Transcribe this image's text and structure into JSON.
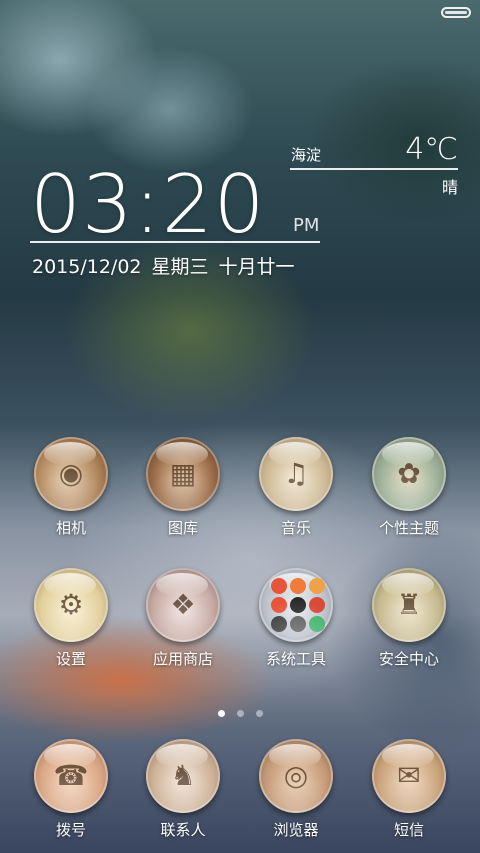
{
  "clock": {
    "time": "03:20",
    "ampm": "PM",
    "date": "2015/12/02",
    "weekday": "星期三",
    "lunar": "十月廿一"
  },
  "weather": {
    "city": "海淀",
    "temp": "4℃",
    "condition": "晴"
  },
  "apps_row1": [
    {
      "label": "相机",
      "icon": "camera-icon",
      "color": "#b98a5c",
      "glyph": "◉"
    },
    {
      "label": "图库",
      "icon": "gallery-icon",
      "color": "#8a6a55",
      "glyph": "▦"
    },
    {
      "label": "音乐",
      "icon": "music-icon",
      "color": "#d9c7a8",
      "glyph": "♫"
    },
    {
      "label": "个性主题",
      "icon": "theme-icon",
      "color": "#9fb39a",
      "glyph": "✿"
    }
  ],
  "apps_row2": [
    {
      "label": "设置",
      "icon": "settings-icon",
      "color": "#e2d2a6",
      "glyph": "⚙"
    },
    {
      "label": "应用商店",
      "icon": "app-store-icon",
      "color": "#d8c2b6",
      "glyph": "❖"
    },
    {
      "label": "系统工具",
      "icon": "system-tools-icon",
      "color": "#cfd3da",
      "glyph": ""
    },
    {
      "label": "安全中心",
      "icon": "security-icon",
      "color": "#c6b98e",
      "glyph": "♜"
    }
  ],
  "tool_colors": [
    "#e8543a",
    "#f07b3a",
    "#f1a14a",
    "#e8543a",
    "#2b2b2b",
    "#d94a3a",
    "#3a3a3a",
    "#5a5a5a",
    "#3fb36a"
  ],
  "page_indicator": {
    "count": 3,
    "active": 1
  },
  "dock": [
    {
      "label": "拨号",
      "icon": "phone-icon",
      "color": "#d9a683",
      "glyph": "☎"
    },
    {
      "label": "联系人",
      "icon": "contacts-icon",
      "color": "#cdb196",
      "glyph": "♞"
    },
    {
      "label": "浏览器",
      "icon": "browser-icon",
      "color": "#c49a76",
      "glyph": "◎"
    },
    {
      "label": "短信",
      "icon": "messages-icon",
      "color": "#c9a27a",
      "glyph": "✉"
    }
  ]
}
